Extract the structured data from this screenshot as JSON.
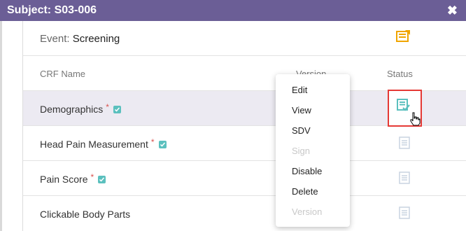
{
  "window": {
    "title": "Subject: S03-006",
    "close_glyph": "✖"
  },
  "event": {
    "label": "Event:",
    "value": "Screening",
    "icon": "event-notes-icon"
  },
  "table": {
    "headers": {
      "crf_name": "CRF Name",
      "version": "Version",
      "status": "Status"
    },
    "rows": [
      {
        "name": "Demographics",
        "required": "*",
        "verified": true,
        "status_icon": "form-complete-icon"
      },
      {
        "name": "Head Pain Measurement",
        "required": "*",
        "verified": true,
        "status_icon": "form-blank-icon"
      },
      {
        "name": "Pain Score",
        "required": "*",
        "verified": true,
        "status_icon": "form-blank-icon"
      },
      {
        "name": "Clickable Body Parts",
        "required": "",
        "verified": false,
        "status_icon": "form-blank-icon"
      }
    ]
  },
  "context_menu": {
    "items": [
      {
        "label": "Edit",
        "enabled": true
      },
      {
        "label": "View",
        "enabled": true
      },
      {
        "label": "SDV",
        "enabled": true
      },
      {
        "label": "Sign",
        "enabled": false
      },
      {
        "label": "Disable",
        "enabled": true
      },
      {
        "label": "Delete",
        "enabled": true
      },
      {
        "label": "Version",
        "enabled": false
      }
    ]
  },
  "colors": {
    "titlebar": "#6b5e96",
    "highlight_row": "#eceaf2",
    "focus_border": "#e53935",
    "check_teal": "#5bc0be",
    "event_icon": "#f0a500"
  }
}
